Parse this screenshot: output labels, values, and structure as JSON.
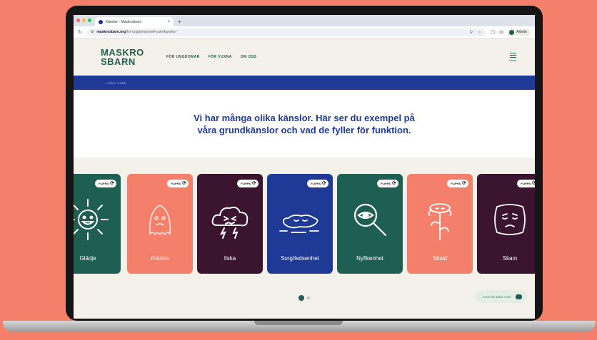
{
  "browser": {
    "tab_title": "Känslor - Maskrosbarn",
    "new_tab": "+",
    "tab_close": "×",
    "url_host": "maskrosbarn.org",
    "url_path": "/for-ungdomar/self-care/kanslor/",
    "profile_name": "Arbete",
    "traffic_colors": [
      "#ff5f57",
      "#febc2e",
      "#28c840"
    ]
  },
  "site": {
    "logo_line1": "MASKRO",
    "logo_line2": "SBARN",
    "nav": [
      "FÖR UNGDOMAR",
      "FÖR VUXNA",
      "OM OSS"
    ],
    "menu_label": "Meny",
    "breadcrumb": "<  SELF CARE",
    "hero_text": "Vi har många olika känslor. Här ser du exempel på våra grundkänslor och vad de fyller för funktion."
  },
  "cards": [
    {
      "label": "Glädje",
      "flip": "FLIPPA",
      "bg": "#1f5e52",
      "fg": "#ffffff",
      "icon": "sun-face-icon"
    },
    {
      "label": "Rädsla",
      "flip": "FLIPPA",
      "bg": "#f47f6b",
      "fg": "#ffffff",
      "icon": "ghost-icon"
    },
    {
      "label": "Ilska",
      "flip": "FLIPPA",
      "bg": "#3b1530",
      "fg": "#ffffff",
      "icon": "storm-cloud-icon"
    },
    {
      "label": "Sorg/ledsenhet",
      "flip": "FLIPPA",
      "bg": "#1e3a96",
      "fg": "#ffffff",
      "icon": "puddle-face-icon"
    },
    {
      "label": "Nyfikenhet",
      "flip": "FLIPPA",
      "bg": "#1f5e52",
      "fg": "#ffffff",
      "icon": "magnifier-eye-icon"
    },
    {
      "label": "Skuld",
      "flip": "FLIPPA",
      "bg": "#f47f6b",
      "fg": "#ffffff",
      "icon": "wilted-flower-icon"
    },
    {
      "label": "Skam",
      "flip": "FLIPPA",
      "bg": "#3b1530",
      "fg": "#ffffff",
      "icon": "ashamed-face-icon"
    }
  ],
  "chat": {
    "label": "CHATTA MED OSS"
  },
  "colors": {
    "brand_green": "#1f5e52",
    "brand_blue": "#1e3a96",
    "coral": "#f47f6b",
    "plum": "#3b1530"
  }
}
